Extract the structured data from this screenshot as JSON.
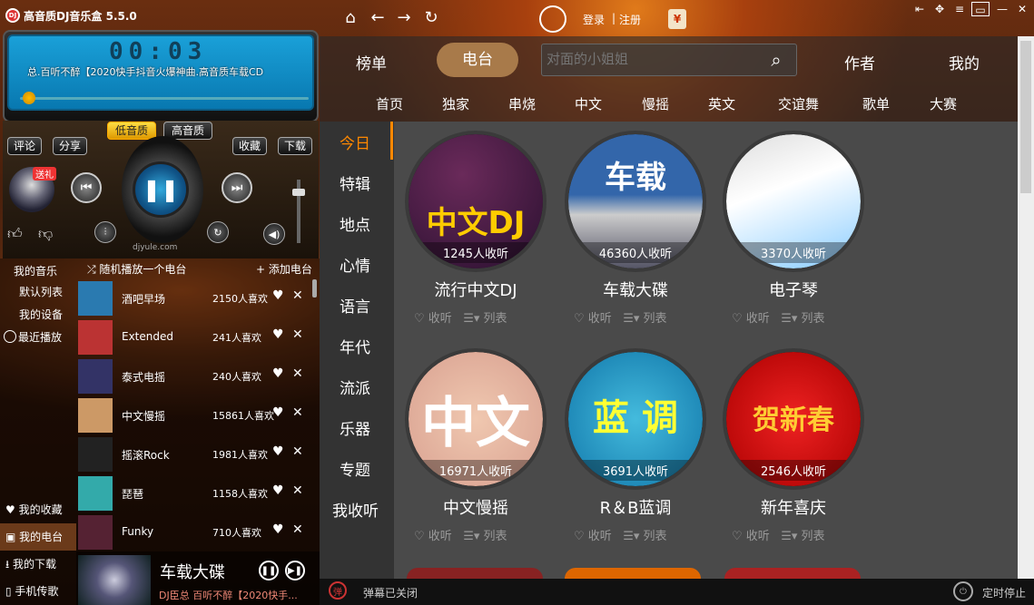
{
  "app": {
    "title": "高音质DJ音乐盒 5.5.0",
    "logo": "DJ"
  },
  "header": {
    "login": "登录",
    "sep": "|",
    "register": "注册",
    "gift": "¥"
  },
  "player": {
    "time": "00:03",
    "ticker": "总.百听不醉【2020快手抖音火爆神曲.高音质车载CD",
    "progress": 0.02,
    "quality_low": "低音质",
    "quality_high": "高音质",
    "comment": "评论",
    "share": "分享",
    "collect": "收藏",
    "download": "下载",
    "gift_badge": "送礼",
    "brand": "djyule.com"
  },
  "sidebar": {
    "my_music": "我的音乐",
    "default_list": "默认列表",
    "my_device": "我的设备",
    "recent": "最近播放",
    "my_collect": "我的收藏",
    "my_station": "我的电台",
    "my_download": "我的下载",
    "phone_transfer": "手机传歌"
  },
  "list": {
    "random": "随机播放一个电台",
    "add": "添加电台",
    "rows": [
      {
        "name": "酒吧早场",
        "likes": "2150人喜欢"
      },
      {
        "name": "Extended",
        "likes": "241人喜欢"
      },
      {
        "name": "泰式电摇",
        "likes": "240人喜欢"
      },
      {
        "name": "中文慢摇",
        "likes": "15861人喜欢"
      },
      {
        "name": "摇滚Rock",
        "likes": "1981人喜欢"
      },
      {
        "name": "琵琶",
        "likes": "1158人喜欢"
      },
      {
        "name": "Funky",
        "likes": "710人喜欢"
      }
    ]
  },
  "mini": {
    "title": "车载大碟",
    "subtitle": "DJ臣总 百听不醉【2020快手..."
  },
  "tabs": {
    "chart": "榜单",
    "radio": "电台",
    "author": "作者",
    "mine": "我的"
  },
  "search": {
    "placeholder": "对面的小姐姐"
  },
  "subnav": [
    "首页",
    "独家",
    "串烧",
    "中文",
    "慢摇",
    "英文",
    "交谊舞",
    "歌单",
    "大赛"
  ],
  "categories": [
    "今日",
    "特辑",
    "地点",
    "心情",
    "语言",
    "年代",
    "流派",
    "乐器",
    "专题",
    "我收听"
  ],
  "cards": [
    {
      "title": "流行中文DJ",
      "count": "1245人收听",
      "art": "中文DJ"
    },
    {
      "title": "车载大碟",
      "count": "46360人收听",
      "art": "车载"
    },
    {
      "title": "电子琴",
      "count": "3370人收听",
      "art": ""
    },
    {
      "title": "中文慢摇",
      "count": "16971人收听",
      "art": "中文"
    },
    {
      "title": "R＆B蓝调",
      "count": "3691人收听",
      "art": "蓝 调"
    },
    {
      "title": "新年喜庆",
      "count": "2546人收听",
      "art": "贺新春"
    }
  ],
  "card_actions": {
    "listen": "收听",
    "list": "列表"
  },
  "status": {
    "danmu": "弹幕已关闭",
    "timer": "定时停止"
  }
}
